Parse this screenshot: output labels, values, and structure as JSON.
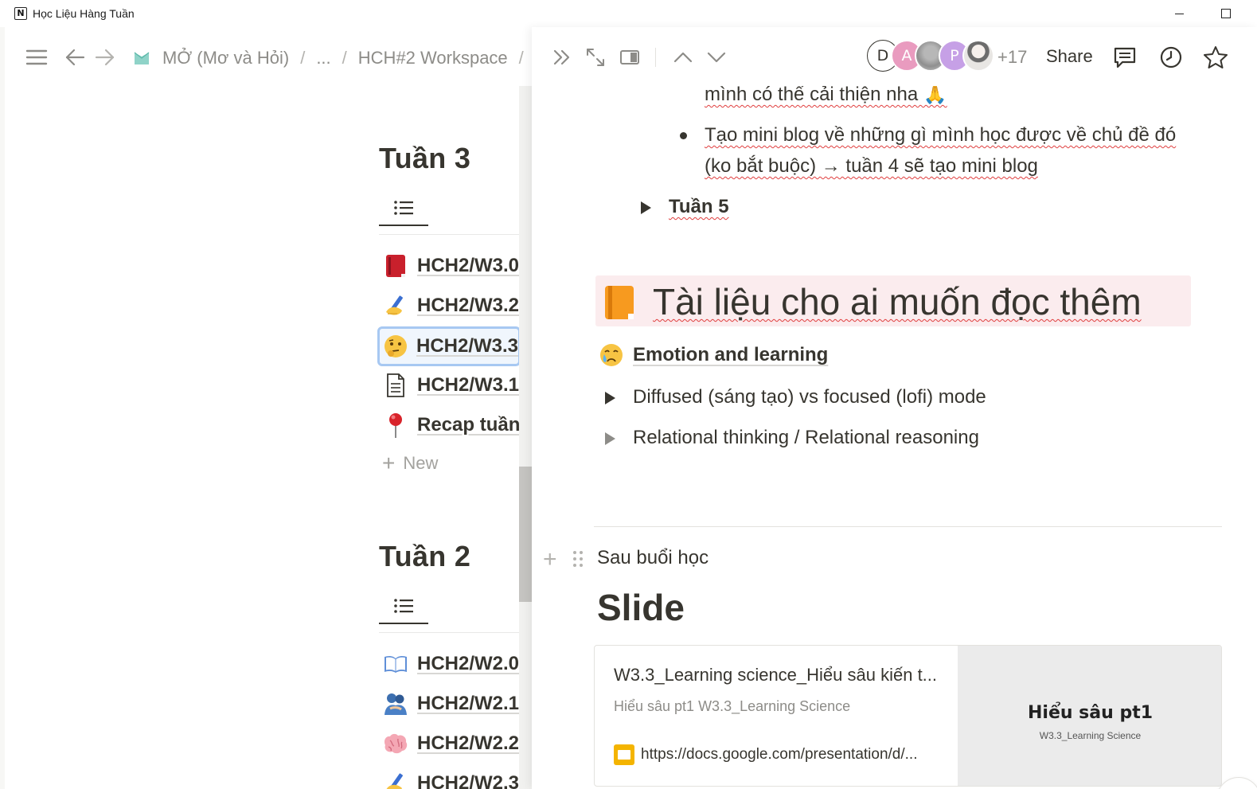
{
  "window": {
    "title": "Học Liệu Hàng Tuần",
    "app_logo": "N"
  },
  "left_topbar": {
    "breadcrumbs": [
      "MỞ (Mơ và Hỏi)",
      "...",
      "HCH#2 Workspace",
      "/"
    ]
  },
  "left": {
    "week3": {
      "title": "Tuần 3",
      "items": [
        {
          "icon": "red-book-icon",
          "emoji": "📕",
          "label": "HCH2/W3.0"
        },
        {
          "icon": "writing-hand-icon",
          "emoji": "✍",
          "label": "HCH2/W3.2"
        },
        {
          "icon": "thinking-face-icon",
          "emoji": "🤔",
          "label": "HCH2/W3.3"
        },
        {
          "icon": "document-icon",
          "emoji": "🗎",
          "label": "HCH2/W3.1"
        },
        {
          "icon": "pushpin-icon",
          "emoji": "📍",
          "label": "Recap tuần"
        }
      ],
      "new_label": "New"
    },
    "week2": {
      "title": "Tuần 2",
      "items": [
        {
          "icon": "open-book-icon",
          "emoji": "📖",
          "label": "HCH2/W2.0"
        },
        {
          "icon": "people-hugging-icon",
          "emoji": "🫂",
          "label": "HCH2/W2.1"
        },
        {
          "icon": "brain-icon",
          "emoji": "🧠",
          "label": "HCH2/W2.2"
        },
        {
          "icon": "writing-hand-icon",
          "emoji": "✍",
          "label": "HCH2/W2.3"
        }
      ]
    }
  },
  "peek_topbar": {
    "avatars": [
      "D",
      "A",
      "",
      "P",
      ""
    ],
    "more_count": "+17",
    "share_label": "Share"
  },
  "peek": {
    "line1": "mình có thể cải thiện nha 🙏",
    "bullet_line1": "Tạo mini blog về những gì mình học được về chủ đề đó",
    "bullet_line2": "(ko bắt buộc) → tuần 4 sẽ tạo mini blog",
    "toggle_week5": "Tuần 5",
    "heading": "Tài liệu cho ai muốn đọc thêm",
    "emotion_link": "Emotion and learning",
    "toggle1": "Diffused (sáng tạo) vs focused (lofi) mode",
    "toggle2": "Relational thinking / Relational reasoning",
    "after_class": "Sau buổi học",
    "slide_heading": "Slide",
    "bookmark": {
      "title": "W3.3_Learning science_Hiểu sâu kiến t...",
      "description": "Hiểu sâu pt1 W3.3_Learning Science",
      "url": "https://docs.google.com/presentation/d/...",
      "thumb_title": "Hiểu sâu pt1",
      "thumb_subtitle": "W3.3_Learning Science"
    },
    "help_label": "?"
  },
  "colors": {
    "text": "#37352f",
    "muted": "#8d8c88",
    "heading_bg": "#fbecee",
    "selection_border": "#a7c8f2",
    "spellcheck": "#e03e3e"
  }
}
